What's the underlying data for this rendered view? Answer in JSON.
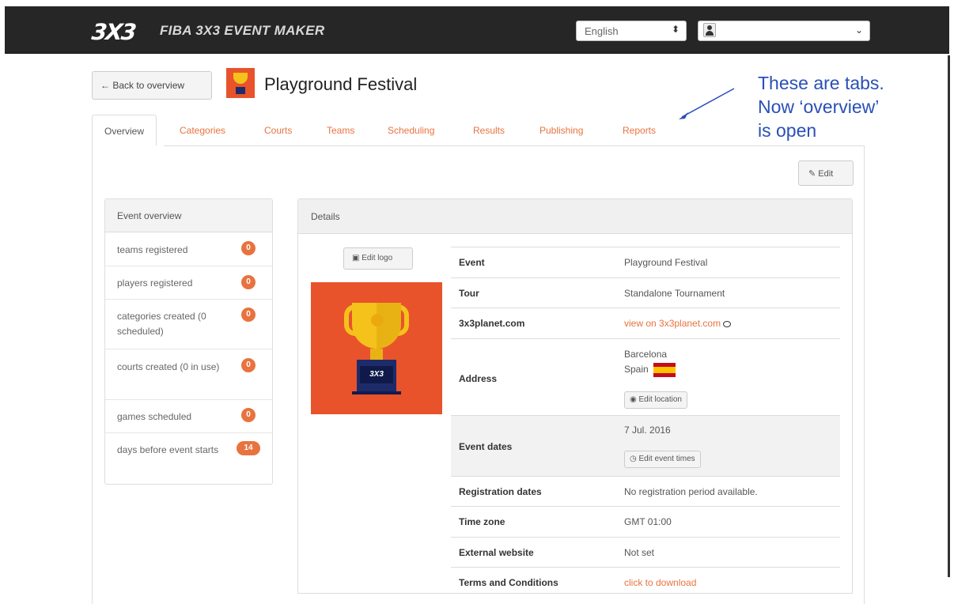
{
  "topbar": {
    "logo": "3X3",
    "brand": "FIBA 3X3 EVENT MAKER",
    "language": "English"
  },
  "header": {
    "back_label": "← Back to overview",
    "title": "Playground Festival"
  },
  "tabs": [
    {
      "label": "Overview",
      "active": true
    },
    {
      "label": "Categories"
    },
    {
      "label": "Courts"
    },
    {
      "label": "Teams"
    },
    {
      "label": "Scheduling"
    },
    {
      "label": "Results"
    },
    {
      "label": "Publishing"
    },
    {
      "label": "Reports"
    }
  ],
  "edit_label": "Edit",
  "annotation": {
    "lines": [
      "These are tabs.",
      "Now ‘overview’",
      "is open"
    ]
  },
  "overview": {
    "title": "Event overview",
    "items": [
      {
        "label": "teams registered",
        "count": "0"
      },
      {
        "label": "players registered",
        "count": "0"
      },
      {
        "label": "categories created (0 scheduled)",
        "count": "0"
      },
      {
        "label": "courts created (0 in use)",
        "count": "0"
      },
      {
        "label": "games scheduled",
        "count": "0"
      },
      {
        "label": "days before event starts",
        "count": "14"
      }
    ]
  },
  "details": {
    "title": "Details",
    "edit_logo": "Edit logo",
    "logo_text": "3X3",
    "rows": {
      "event": {
        "key": "Event",
        "value": "Playground Festival"
      },
      "tour": {
        "key": "Tour",
        "value": "Standalone Tournament"
      },
      "planet": {
        "key": "3x3planet.com",
        "value": "view on 3x3planet.com"
      },
      "address": {
        "key": "Address",
        "city": "Barcelona",
        "country": "Spain",
        "button": "Edit location"
      },
      "dates": {
        "key": "Event dates",
        "value": "7 Jul. 2016",
        "button": "Edit event times"
      },
      "registration": {
        "key": "Registration dates",
        "value": "No registration period available."
      },
      "timezone": {
        "key": "Time zone",
        "value": "GMT 01:00"
      },
      "website": {
        "key": "External website",
        "value": "Not set"
      },
      "terms": {
        "key": "Terms and Conditions",
        "value": "click to download"
      }
    }
  },
  "colors": {
    "accent": "#e8733f",
    "topbar": "#262626",
    "annotation": "#2a4fb7"
  }
}
